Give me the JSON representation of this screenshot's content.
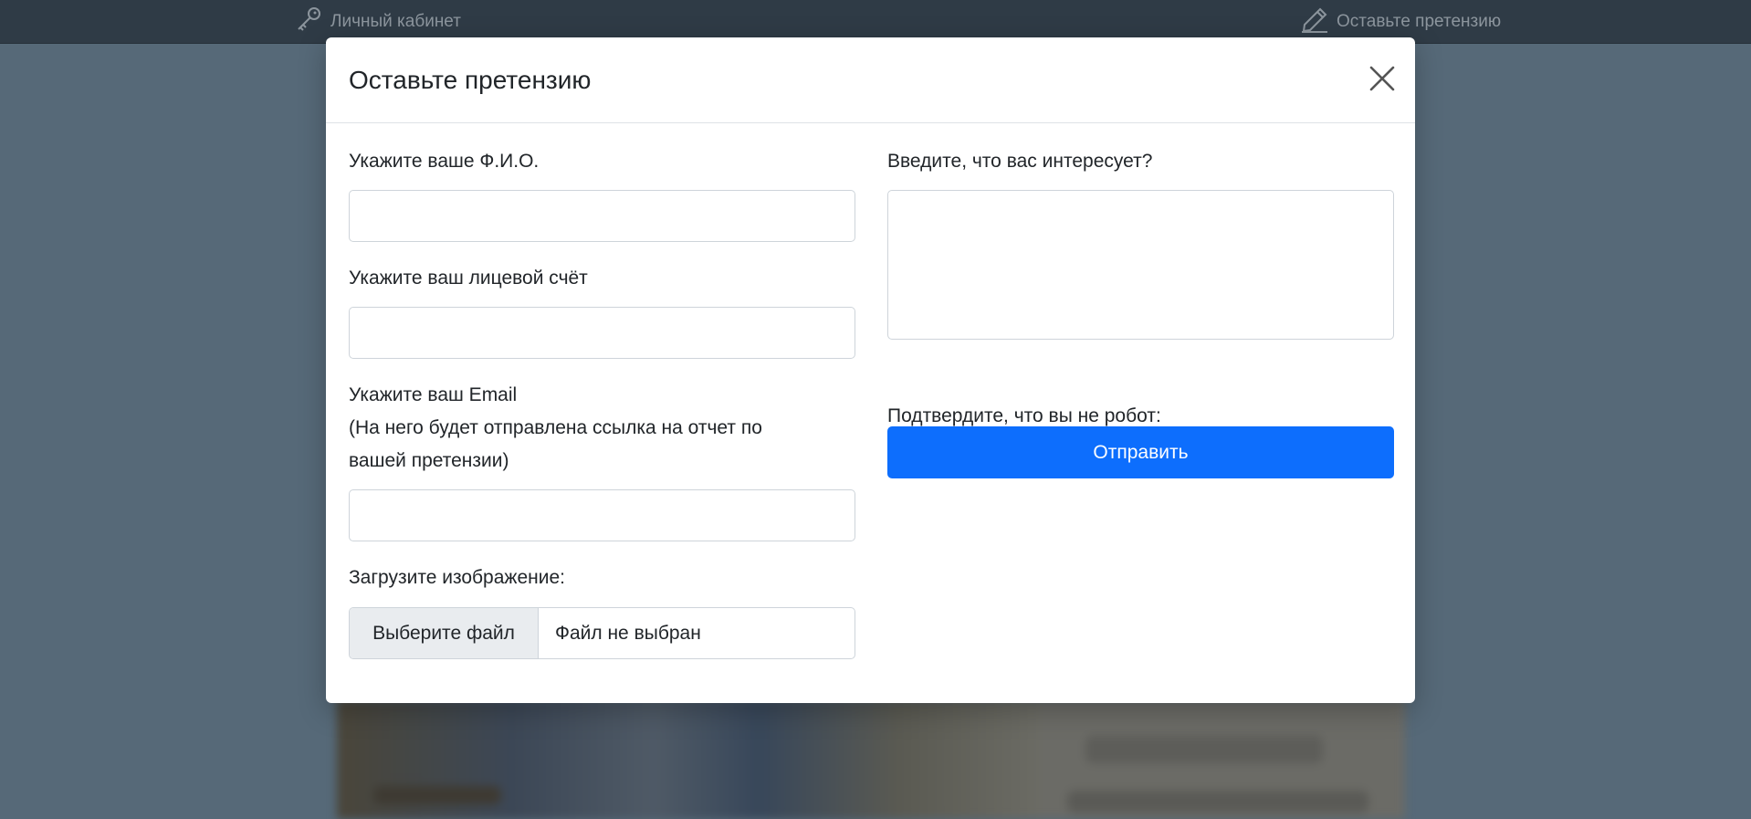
{
  "nav": {
    "account_label": "Личный кабинет",
    "account_icon": "key-icon",
    "claim_label": "Оставьте претензию",
    "claim_icon": "pencil-icon"
  },
  "modal": {
    "title": "Оставьте претензию",
    "close_icon": "close-icon",
    "fields": {
      "fio_label": "Укажите ваше Ф.И.О.",
      "fio_value": "",
      "account_label": "Укажите ваш лицевой счёт",
      "account_value": "",
      "email_label_line1": "Укажите ваш Email",
      "email_label_line2": "(На него будет отправлена ссылка на отчет по",
      "email_label_line3": "вашей претензии)",
      "email_value": "",
      "image_label": "Загрузите изображение:",
      "file_button": "Выберите файл",
      "file_status": "Файл не выбран",
      "interest_label": "Введите, что вас интересует?",
      "interest_value": "",
      "captcha_label": "Подтвердите, что вы не робот:"
    },
    "submit_label": "Отправить"
  },
  "colors": {
    "primary": "#0d6efd",
    "backdrop": "#566978",
    "topbar": "#2f3b46"
  }
}
